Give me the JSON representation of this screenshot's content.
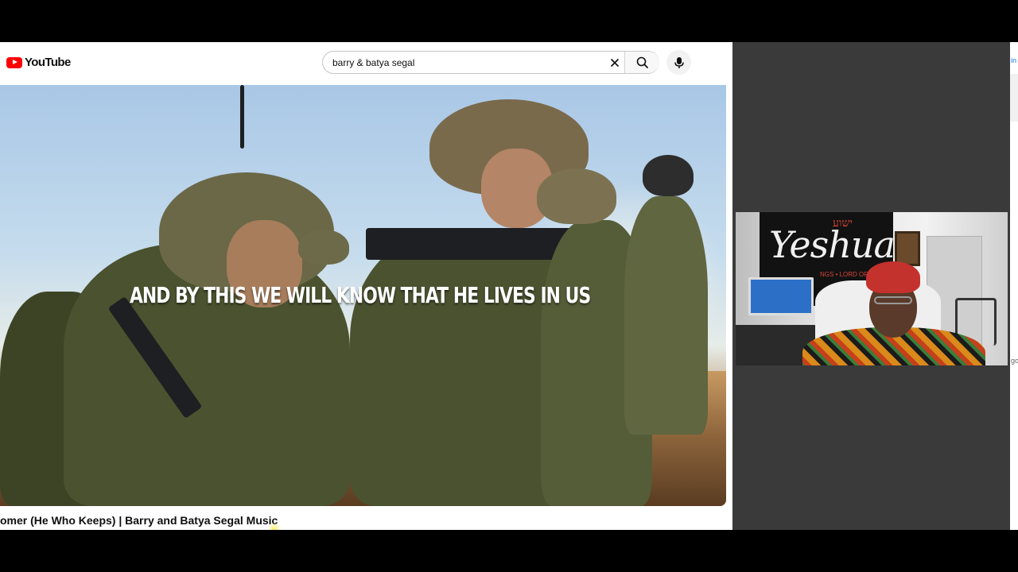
{
  "youtube": {
    "logo_text": "YouTube",
    "search": {
      "value": "barry & batya segal",
      "clear_icon": "close-icon",
      "search_icon": "search-icon",
      "mic_icon": "microphone-icon"
    },
    "video": {
      "caption": "AND BY THIS WE WILL KNOW THAT HE LIVES IN US",
      "title": "omer (He Who Keeps) | Barry and Batya Segal Music"
    }
  },
  "webcam": {
    "banner_text": "Yeshua",
    "banner_hebrew": "ישוע",
    "banner_subtext": "NGS • LORD OF LO"
  },
  "edge_window": {
    "top_label": "in",
    "bottom_label": "go"
  },
  "colors": {
    "youtube_red": "#ff0000",
    "meeting_panel_bg": "#3a3a3a"
  }
}
